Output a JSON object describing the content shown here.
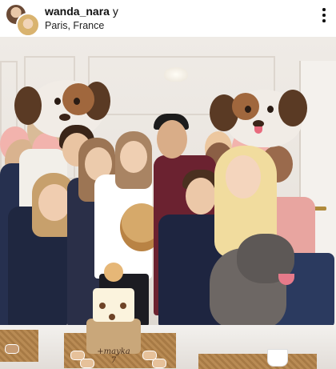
{
  "header": {
    "username": "wanda_nara",
    "username_suffix": "y",
    "location": "Paris, France"
  },
  "icons": {
    "avatar_story_ring": "avatar-stack-icon",
    "more_options": "more-vertical-icon"
  },
  "photo": {
    "cake_text": "+mayka 7"
  },
  "colors": {
    "dog_balloon_brown": "#a0673d",
    "sweater_pink": "#e8a5a0",
    "balloon_pink": "#f2b3ad",
    "balloon_tan": "#d9b38f"
  }
}
